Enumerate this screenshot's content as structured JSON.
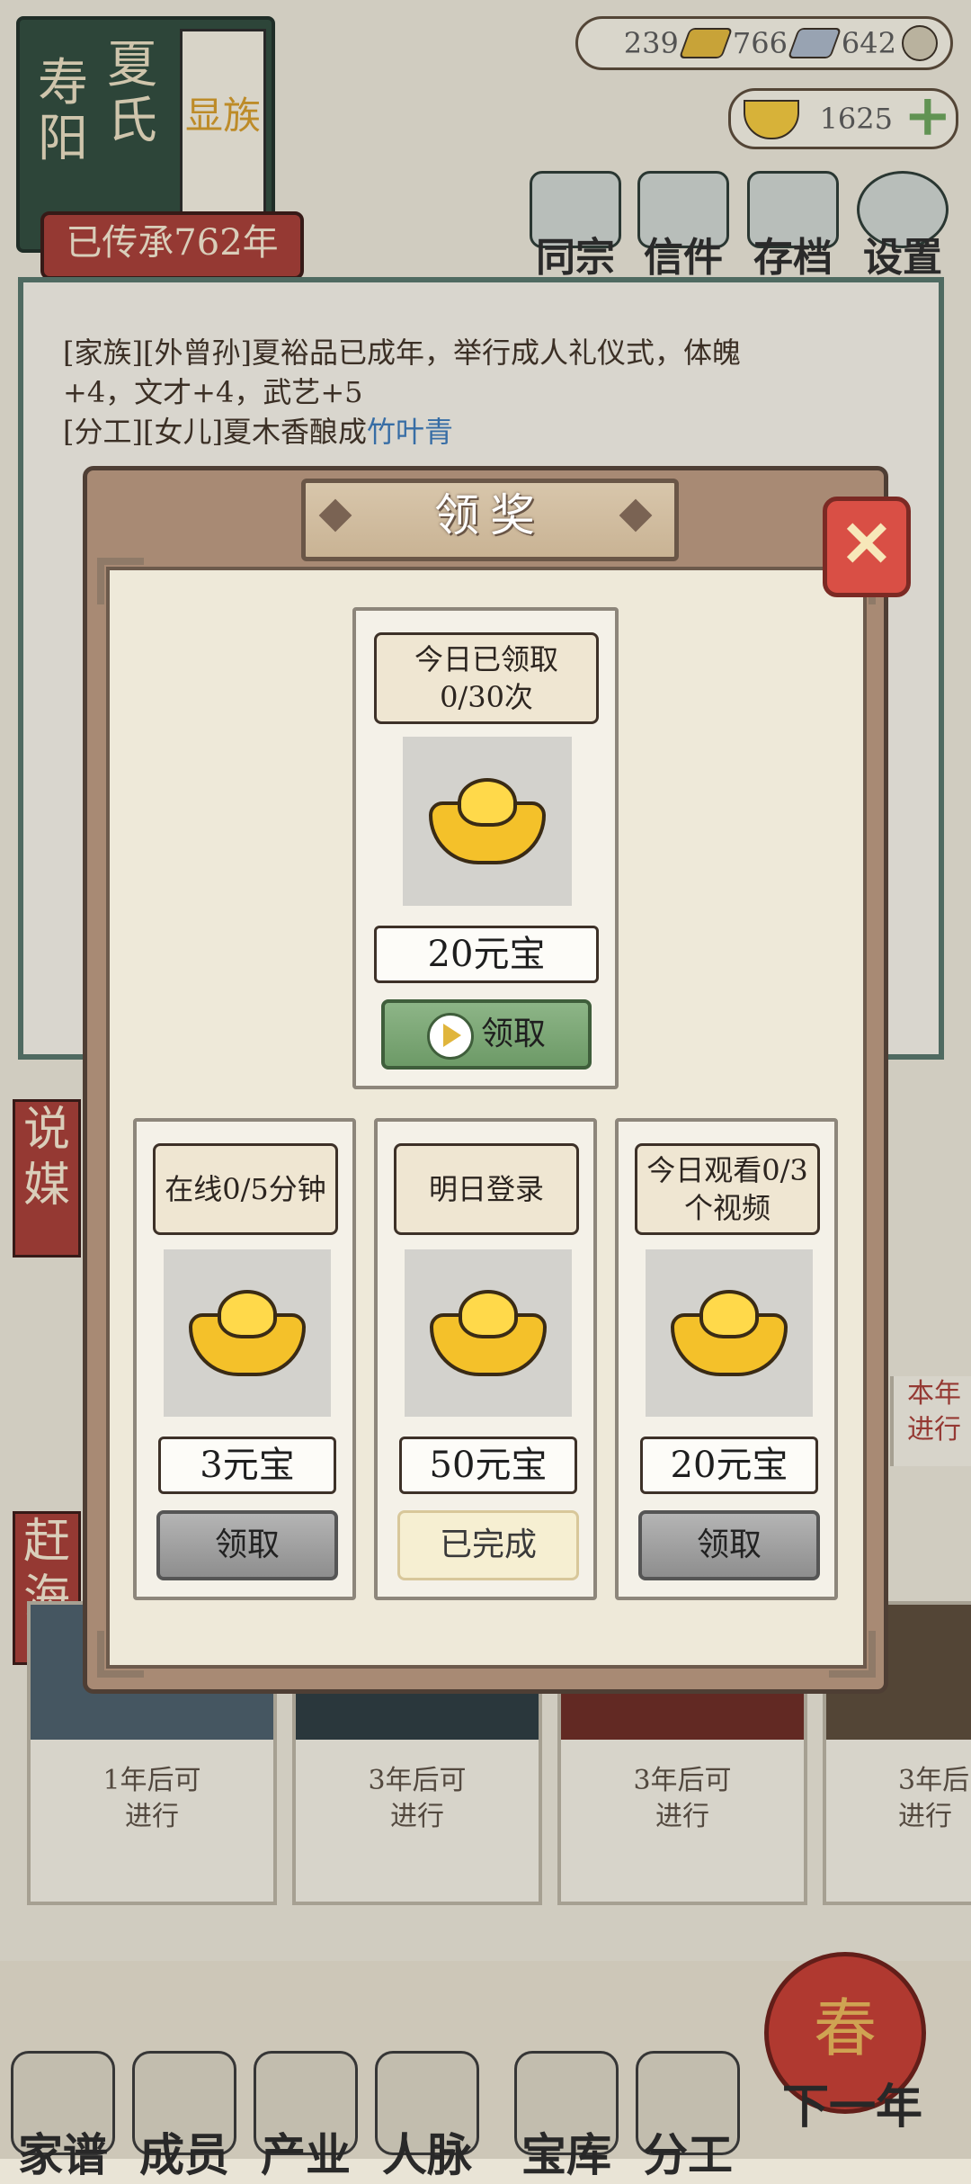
{
  "banner": {
    "col1": "寿阳",
    "col2": "夏氏",
    "page_label": "显族",
    "legacy": "已传承762年"
  },
  "currency": {
    "gold": "239",
    "silver": "766",
    "coin": "642",
    "yuanbao": "1625"
  },
  "topnav": [
    {
      "label": "同宗",
      "icon": "clan-book-icon"
    },
    {
      "label": "信件",
      "icon": "letter-icon"
    },
    {
      "label": "存档",
      "icon": "save-scroll-icon"
    },
    {
      "label": "设置",
      "icon": "settings-gear-icon"
    }
  ],
  "log": {
    "line1": "[家族][外曾孙]夏裕品已成年，举行成人礼仪式，体魄",
    "line2": "+4，文才+4，武艺+5",
    "line3_prefix": "[分工][女儿]夏木香酿成",
    "line3_blue": "竹叶青"
  },
  "side_tags": {
    "matchmaking": "说媒",
    "sea": "赶海"
  },
  "background_cards": [
    {
      "text1": "1年后可",
      "text2": "进行"
    },
    {
      "text1": "3年后可",
      "text2": "进行"
    },
    {
      "text1": "3年后可",
      "text2": "进行"
    },
    {
      "text1": "3年后",
      "text2": "进行"
    }
  ],
  "right_side": {
    "text1": "本年",
    "text2": "进行"
  },
  "modal": {
    "title": "领奖",
    "close_glyph": "✕",
    "featured": {
      "header": "今日已领取0/30次",
      "amount": "20元宝",
      "button": "领取"
    },
    "cards": [
      {
        "header": "在线0/5分钟",
        "amount": "3元宝",
        "button": "领取",
        "state": "available"
      },
      {
        "header": "明日登录",
        "amount": "50元宝",
        "button": "已完成",
        "state": "done"
      },
      {
        "header": "今日观看0/3个视频",
        "amount": "20元宝",
        "button": "领取",
        "state": "available"
      }
    ]
  },
  "bottom_nav": [
    {
      "label": "家谱",
      "icon": "family-tree-book-icon"
    },
    {
      "label": "成员",
      "icon": "members-person-icon"
    },
    {
      "label": "产业",
      "icon": "industry-building-icon"
    },
    {
      "label": "人脉",
      "icon": "network-icon"
    },
    {
      "label": "宝库",
      "icon": "treasure-chest-icon"
    },
    {
      "label": "分工",
      "icon": "tasks-scroll-icon"
    }
  ],
  "next_year": {
    "label": "下一年",
    "lantern": "春"
  },
  "colors": {
    "accent_red": "#a63d36",
    "banner_green": "#2f4a3d",
    "modal_brown": "#a88a74",
    "button_green": "#6d9a67",
    "gold": "#f4c12a"
  }
}
